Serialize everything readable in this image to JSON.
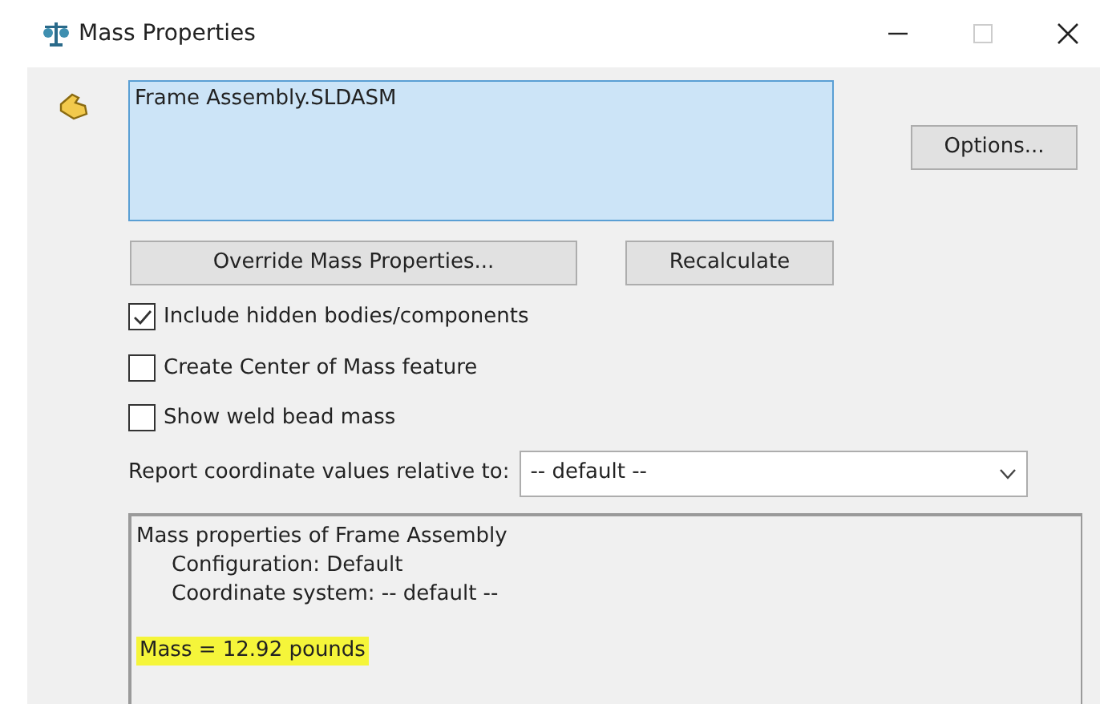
{
  "window": {
    "title": "Mass Properties"
  },
  "selection": {
    "items": [
      "Frame Assembly.SLDASM"
    ]
  },
  "buttons": {
    "options": "Options...",
    "override": "Override Mass Properties...",
    "recalculate": "Recalculate"
  },
  "checkboxes": [
    {
      "label": "Include hidden bodies/components",
      "checked": true
    },
    {
      "label": "Create Center of Mass feature",
      "checked": false
    },
    {
      "label": "Show weld bead mass",
      "checked": false
    }
  ],
  "coordinate": {
    "label": "Report coordinate values relative to:",
    "value": "-- default --"
  },
  "results": [
    {
      "text": "Mass properties of Frame Assembly",
      "kind": "heading",
      "highlighted": false
    },
    {
      "text": "Configuration: Default",
      "kind": "detail",
      "highlighted": false
    },
    {
      "text": "Coordinate system: -- default --",
      "kind": "detail",
      "highlighted": false
    },
    {
      "text": "Mass = 12.92 pounds",
      "kind": "result",
      "highlighted": true
    }
  ]
}
